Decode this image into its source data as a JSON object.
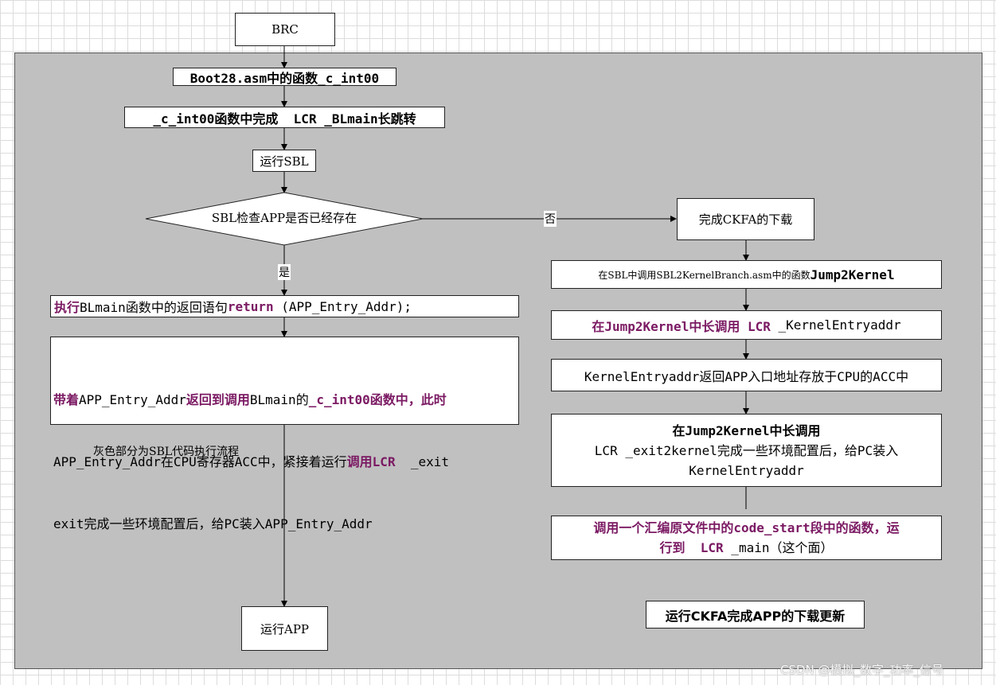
{
  "nodes": {
    "brc": "BRC",
    "boot28": "Boot28.asm中的函数_c_int00",
    "cint00": "_c_int00函数中完成  LCR _BLmain长跳转",
    "run_sbl": "运行SBL",
    "sbl_check": "SBL检查APP是否已经存在",
    "ckfa_download": "完成CKFA的下载",
    "execute_return": {
      "t1": "执行",
      "t2": "BLmain函数中的返回语句",
      "t3": "return",
      "t4": " (APP_Entry_Addr);"
    },
    "return_with": {
      "l1a": "带着",
      "l1b": "APP_Entry_Addr",
      "l1c": "返回到调用",
      "l1d": "BLmain的",
      "l1e": "_c_int00函数中，此时",
      "l2a": "APP_Entry_Addr在CPU寄存器ACC中，紧接着运行",
      "l2b": "调用LCR",
      "l2c": "  _exit",
      "l3": "exit完成一些环境配置后，给PC装入APP_Entry_Addr"
    },
    "run_app": "运行APP",
    "jump2kernel_call": {
      "t1": "在SBL中调用SBL2KernelBranch.asm中的函数",
      "t2": "Jump2Kernel"
    },
    "lcr_kernelentry": {
      "t1": "在Jump2Kernel中长调用 LCR",
      "t2": " _KernelEntryaddr"
    },
    "kernelentry_return": "KernelEntryaddr返回APP入口地址存放于CPU的ACC中",
    "lcr_exit2kernel": {
      "l1": "在Jump2Kernel中长调用",
      "l2": "LCR _exit2kernel完成一些环境配置后，给PC装入",
      "l3": "KernelEntryaddr"
    },
    "call_code_start": {
      "l1": "调用一个汇编原文件中的code_start段中的函数，运",
      "l2a": "行到  LCR",
      "l2b": " _main（这个面）"
    }
  },
  "edge_labels": {
    "no": "否",
    "yes": "是"
  },
  "annotations": {
    "gray_area_note": "灰色部分为SBL代码执行流程",
    "legend": "运行CKFA完成APP的下载更新"
  },
  "watermark": "CSDN @模拟_数字_功率_信号",
  "colors": {
    "background": "#ffffff",
    "grid": "#dcdcdc",
    "sbl_region": "#c0c0c0",
    "highlight_text": "#7b1a63",
    "node_fill": "#ffffff"
  }
}
